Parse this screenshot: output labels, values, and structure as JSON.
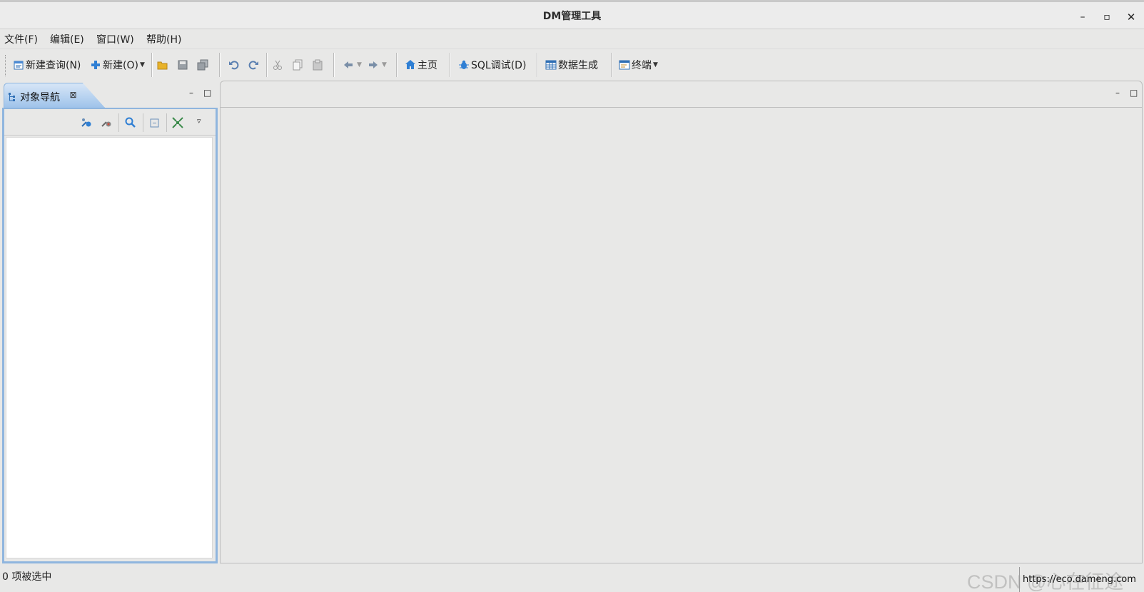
{
  "window": {
    "title": "DM管理工具"
  },
  "menu": {
    "file": "文件(F)",
    "edit": "编辑(E)",
    "window": "窗口(W)",
    "help": "帮助(H)"
  },
  "toolbar": {
    "new_query": "新建查询(N)",
    "new": "新建(O)",
    "home": "主页",
    "sql_debug": "SQL调试(D)",
    "data_gen": "数据生成",
    "terminal": "终端"
  },
  "left_panel": {
    "tab_label": "对象导航"
  },
  "status": {
    "selection": "0  项被选中",
    "url": "https://eco.dameng.com"
  },
  "watermark": "CSDN @心在征途",
  "colors": {
    "accent": "#8fb5de",
    "tab_gradient_top": "#d7e6f7",
    "tab_gradient_bottom": "#9fc3ea"
  }
}
